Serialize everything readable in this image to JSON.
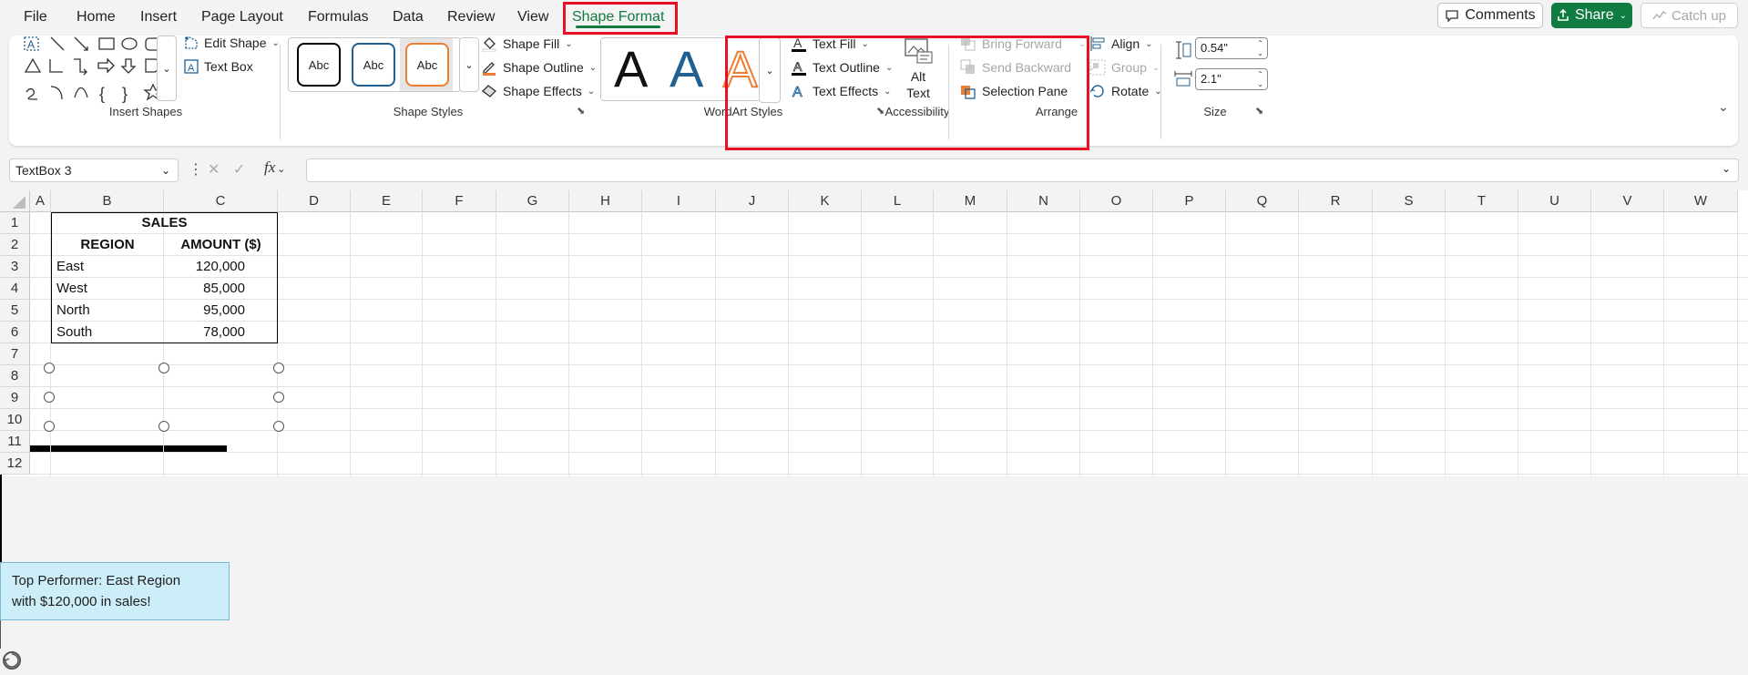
{
  "menu": {
    "tabs": [
      "File",
      "Home",
      "Insert",
      "Page Layout",
      "Formulas",
      "Data",
      "Review",
      "View",
      "Shape Format"
    ],
    "active": "Shape Format",
    "comments": "Comments",
    "share": "Share",
    "catchup": "Catch up"
  },
  "ribbon": {
    "insert_shapes": {
      "label": "Insert Shapes",
      "edit_shape": "Edit Shape",
      "text_box": "Text Box"
    },
    "shape_styles": {
      "label": "Shape Styles",
      "samples": [
        "Abc",
        "Abc",
        "Abc"
      ],
      "fill": "Shape Fill",
      "outline": "Shape Outline",
      "effects": "Shape Effects"
    },
    "wordart": {
      "label": "WordArt Styles",
      "glyph": "A",
      "fill": "Text Fill",
      "outline": "Text Outline",
      "effects": "Text Effects"
    },
    "accessibility": {
      "label": "Accessibility",
      "alt_text_line1": "Alt",
      "alt_text_line2": "Text"
    },
    "arrange": {
      "label": "Arrange",
      "bring_forward": "Bring Forward",
      "send_backward": "Send Backward",
      "selection_pane": "Selection Pane",
      "align": "Align",
      "group": "Group",
      "rotate": "Rotate"
    },
    "size": {
      "label": "Size",
      "height": "0.54\"",
      "width": "2.1\""
    }
  },
  "formula_bar": {
    "name_box": "TextBox 3",
    "formula": "",
    "fx": "fx"
  },
  "sheet": {
    "columns": [
      "A",
      "B",
      "C",
      "D",
      "E",
      "F",
      "G",
      "H",
      "I",
      "J",
      "K",
      "L",
      "M",
      "N",
      "O",
      "P",
      "Q",
      "R",
      "S",
      "T",
      "U",
      "V",
      "W"
    ],
    "rows": [
      "1",
      "2",
      "3",
      "4",
      "5",
      "6",
      "7",
      "8",
      "9",
      "10",
      "11",
      "12"
    ],
    "table": {
      "title": "SALES",
      "headers": [
        "REGION",
        "AMOUNT ($)"
      ],
      "rows": [
        [
          "East",
          "120,000"
        ],
        [
          "West",
          "85,000"
        ],
        [
          "North",
          "95,000"
        ],
        [
          "South",
          "78,000"
        ]
      ]
    },
    "textbox": {
      "line1": "Top Performer: East Region",
      "line2": "with $120,000 in sales!",
      "fill": "#cdeef9"
    }
  },
  "colors": {
    "accent": "#107c41",
    "highlight": "#e81123",
    "wordart_blue": "#1f5f91",
    "wordart_orange": "#ed7d31"
  }
}
